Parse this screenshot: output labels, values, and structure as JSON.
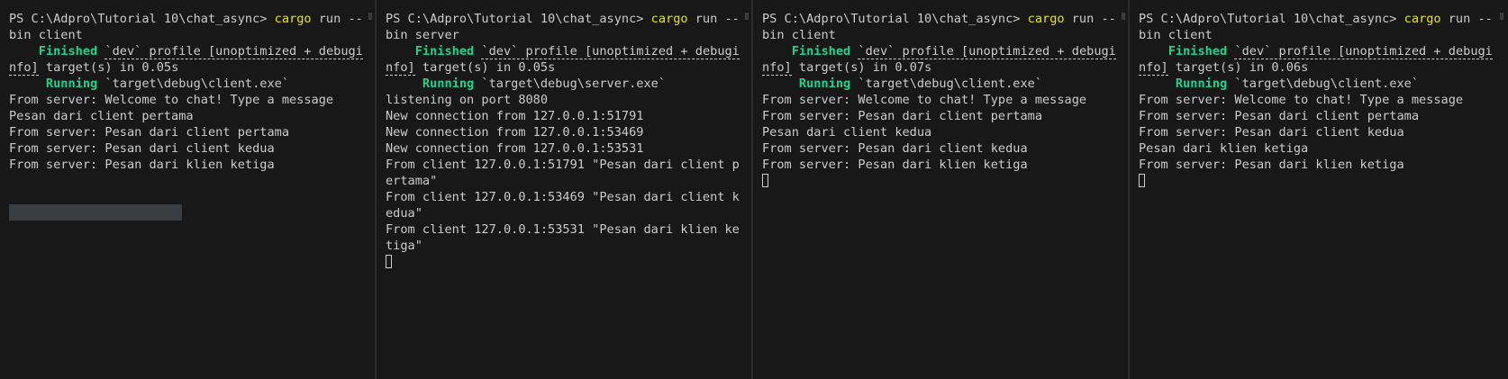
{
  "panes": [
    {
      "name": "client-1",
      "lines": [
        {
          "segs": [
            {
              "t": "PS C:\\Adpro\\Tutorial 10\\chat_async> "
            },
            {
              "t": "cargo",
              "c": "yellow"
            },
            {
              "t": " run --"
            }
          ]
        },
        {
          "segs": [
            {
              "t": "bin client"
            }
          ]
        },
        {
          "segs": [
            {
              "t": "    "
            },
            {
              "t": "Finished",
              "c": "green"
            },
            {
              "t": " "
            },
            {
              "t": "`dev` profile [unoptimized + debugi",
              "c": "dash"
            }
          ]
        },
        {
          "segs": [
            {
              "t": "nfo]",
              "c": "dash"
            },
            {
              "t": " target(s) in 0.05s"
            }
          ]
        },
        {
          "segs": [
            {
              "t": "     "
            },
            {
              "t": "Running",
              "c": "green"
            },
            {
              "t": " `target\\debug\\client.exe`"
            }
          ]
        },
        {
          "segs": [
            {
              "t": "From server: Welcome to chat! Type a message"
            }
          ]
        },
        {
          "segs": [
            {
              "t": "Pesan dari client pertama"
            }
          ]
        },
        {
          "segs": [
            {
              "t": "From server: Pesan dari client pertama"
            }
          ]
        },
        {
          "segs": [
            {
              "t": "From server: Pesan dari client kedua"
            }
          ]
        },
        {
          "segs": [
            {
              "t": "From server: Pesan dari klien ketiga"
            }
          ]
        }
      ],
      "cursor": false,
      "selection": true
    },
    {
      "name": "server",
      "lines": [
        {
          "segs": [
            {
              "t": "PS C:\\Adpro\\Tutorial 10\\chat_async> "
            },
            {
              "t": "cargo",
              "c": "yellow"
            },
            {
              "t": " run --"
            }
          ]
        },
        {
          "segs": [
            {
              "t": "bin server"
            }
          ]
        },
        {
          "segs": [
            {
              "t": "    "
            },
            {
              "t": "Finished",
              "c": "green"
            },
            {
              "t": " "
            },
            {
              "t": "`dev` profile [unoptimized + debugi",
              "c": "dash"
            }
          ]
        },
        {
          "segs": [
            {
              "t": "nfo]",
              "c": "dash"
            },
            {
              "t": " target(s) in 0.05s"
            }
          ]
        },
        {
          "segs": [
            {
              "t": "     "
            },
            {
              "t": "Running",
              "c": "green"
            },
            {
              "t": " `target\\debug\\server.exe`"
            }
          ]
        },
        {
          "segs": [
            {
              "t": "listening on port 8080"
            }
          ]
        },
        {
          "segs": [
            {
              "t": "New connection from 127.0.0.1:51791"
            }
          ]
        },
        {
          "segs": [
            {
              "t": "New connection from 127.0.0.1:53469"
            }
          ]
        },
        {
          "segs": [
            {
              "t": "New connection from 127.0.0.1:53531"
            }
          ]
        },
        {
          "segs": [
            {
              "t": "From client 127.0.0.1:51791 \"Pesan dari client p"
            }
          ]
        },
        {
          "segs": [
            {
              "t": "ertama\""
            }
          ]
        },
        {
          "segs": [
            {
              "t": "From client 127.0.0.1:53469 \"Pesan dari client k"
            }
          ]
        },
        {
          "segs": [
            {
              "t": "edua\""
            }
          ]
        },
        {
          "segs": [
            {
              "t": "From client 127.0.0.1:53531 \"Pesan dari klien ke"
            }
          ]
        },
        {
          "segs": [
            {
              "t": "tiga\""
            }
          ]
        }
      ],
      "cursor": true,
      "selection": false
    },
    {
      "name": "client-2",
      "lines": [
        {
          "segs": [
            {
              "t": "PS C:\\Adpro\\Tutorial 10\\chat_async> "
            },
            {
              "t": "cargo",
              "c": "yellow"
            },
            {
              "t": " run --"
            }
          ]
        },
        {
          "segs": [
            {
              "t": "bin client"
            }
          ]
        },
        {
          "segs": [
            {
              "t": "    "
            },
            {
              "t": "Finished",
              "c": "green"
            },
            {
              "t": " "
            },
            {
              "t": "`dev` profile [unoptimized + debugi",
              "c": "dash"
            }
          ]
        },
        {
          "segs": [
            {
              "t": "nfo]",
              "c": "dash"
            },
            {
              "t": " target(s) in 0.07s"
            }
          ]
        },
        {
          "segs": [
            {
              "t": "     "
            },
            {
              "t": "Running",
              "c": "green"
            },
            {
              "t": " `target\\debug\\client.exe`"
            }
          ]
        },
        {
          "segs": [
            {
              "t": "From server: Welcome to chat! Type a message"
            }
          ]
        },
        {
          "segs": [
            {
              "t": "From server: Pesan dari client pertama"
            }
          ]
        },
        {
          "segs": [
            {
              "t": "Pesan dari client kedua"
            }
          ]
        },
        {
          "segs": [
            {
              "t": "From server: Pesan dari client kedua"
            }
          ]
        },
        {
          "segs": [
            {
              "t": "From server: Pesan dari klien ketiga"
            }
          ]
        }
      ],
      "cursor": true,
      "selection": false
    },
    {
      "name": "client-3",
      "lines": [
        {
          "segs": [
            {
              "t": "PS C:\\Adpro\\Tutorial 10\\chat_async> "
            },
            {
              "t": "cargo",
              "c": "yellow"
            },
            {
              "t": " run --"
            }
          ]
        },
        {
          "segs": [
            {
              "t": "bin client"
            }
          ]
        },
        {
          "segs": [
            {
              "t": "    "
            },
            {
              "t": "Finished",
              "c": "green"
            },
            {
              "t": " "
            },
            {
              "t": "`dev` profile [unoptimized + debugi",
              "c": "dash"
            }
          ]
        },
        {
          "segs": [
            {
              "t": "nfo]",
              "c": "dash"
            },
            {
              "t": " target(s) in 0.06s"
            }
          ]
        },
        {
          "segs": [
            {
              "t": "     "
            },
            {
              "t": "Running",
              "c": "green"
            },
            {
              "t": " `target\\debug\\client.exe`"
            }
          ]
        },
        {
          "segs": [
            {
              "t": "From server: Welcome to chat! Type a message"
            }
          ]
        },
        {
          "segs": [
            {
              "t": "From server: Pesan dari client pertama"
            }
          ]
        },
        {
          "segs": [
            {
              "t": "From server: Pesan dari client kedua"
            }
          ]
        },
        {
          "segs": [
            {
              "t": "Pesan dari klien ketiga"
            }
          ]
        },
        {
          "segs": [
            {
              "t": "From server: Pesan dari klien ketiga"
            }
          ]
        }
      ],
      "cursor": true,
      "selection": false
    }
  ]
}
